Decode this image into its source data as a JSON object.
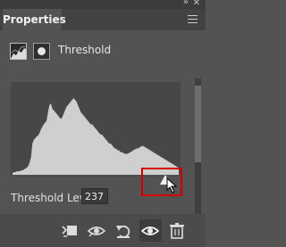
{
  "panel": {
    "tab_label": "Properties",
    "adjustment_title": "Threshold",
    "threshold_label": "Threshold Level:",
    "threshold_value": "237",
    "threshold_fraction": 0.929
  },
  "icons": {
    "collapse": "double-chevron-icon",
    "close": "close-icon",
    "menu": "hamburger-menu-icon",
    "adjustment": "threshold-adjustment-icon",
    "mask": "layer-mask-icon",
    "clip": "clip-to-layer-icon",
    "view_previous": "view-previous-state-icon",
    "reset": "reset-icon",
    "visibility": "eye-icon",
    "delete": "trash-icon"
  },
  "histogram": [
    2,
    3,
    3,
    4,
    4,
    4,
    5,
    5,
    6,
    7,
    8,
    10,
    14,
    20,
    36,
    40,
    42,
    44,
    45,
    48,
    52,
    55,
    58,
    60,
    62,
    72,
    80,
    82,
    76,
    74,
    72,
    70,
    68,
    66,
    64,
    66,
    70,
    74,
    78,
    80,
    82,
    84,
    86,
    88,
    86,
    84,
    80,
    76,
    72,
    70,
    68,
    66,
    64,
    62,
    60,
    58,
    58,
    56,
    54,
    52,
    50,
    48,
    46,
    46,
    44,
    42,
    40,
    38,
    36,
    36,
    34,
    32,
    30,
    30,
    28,
    28,
    26,
    26,
    25,
    24,
    24,
    24,
    25,
    26,
    27,
    28,
    29,
    30,
    30,
    31,
    32,
    33,
    33,
    32,
    31,
    30,
    29,
    28,
    27,
    26,
    25,
    24,
    23,
    22,
    21,
    20,
    19,
    18,
    17,
    16,
    15,
    14,
    13,
    12,
    11,
    10,
    9,
    8
  ],
  "colors": {
    "panel_bg": "#535353",
    "histogram_fill": "#cfcfcf",
    "highlight": "#d40000"
  }
}
